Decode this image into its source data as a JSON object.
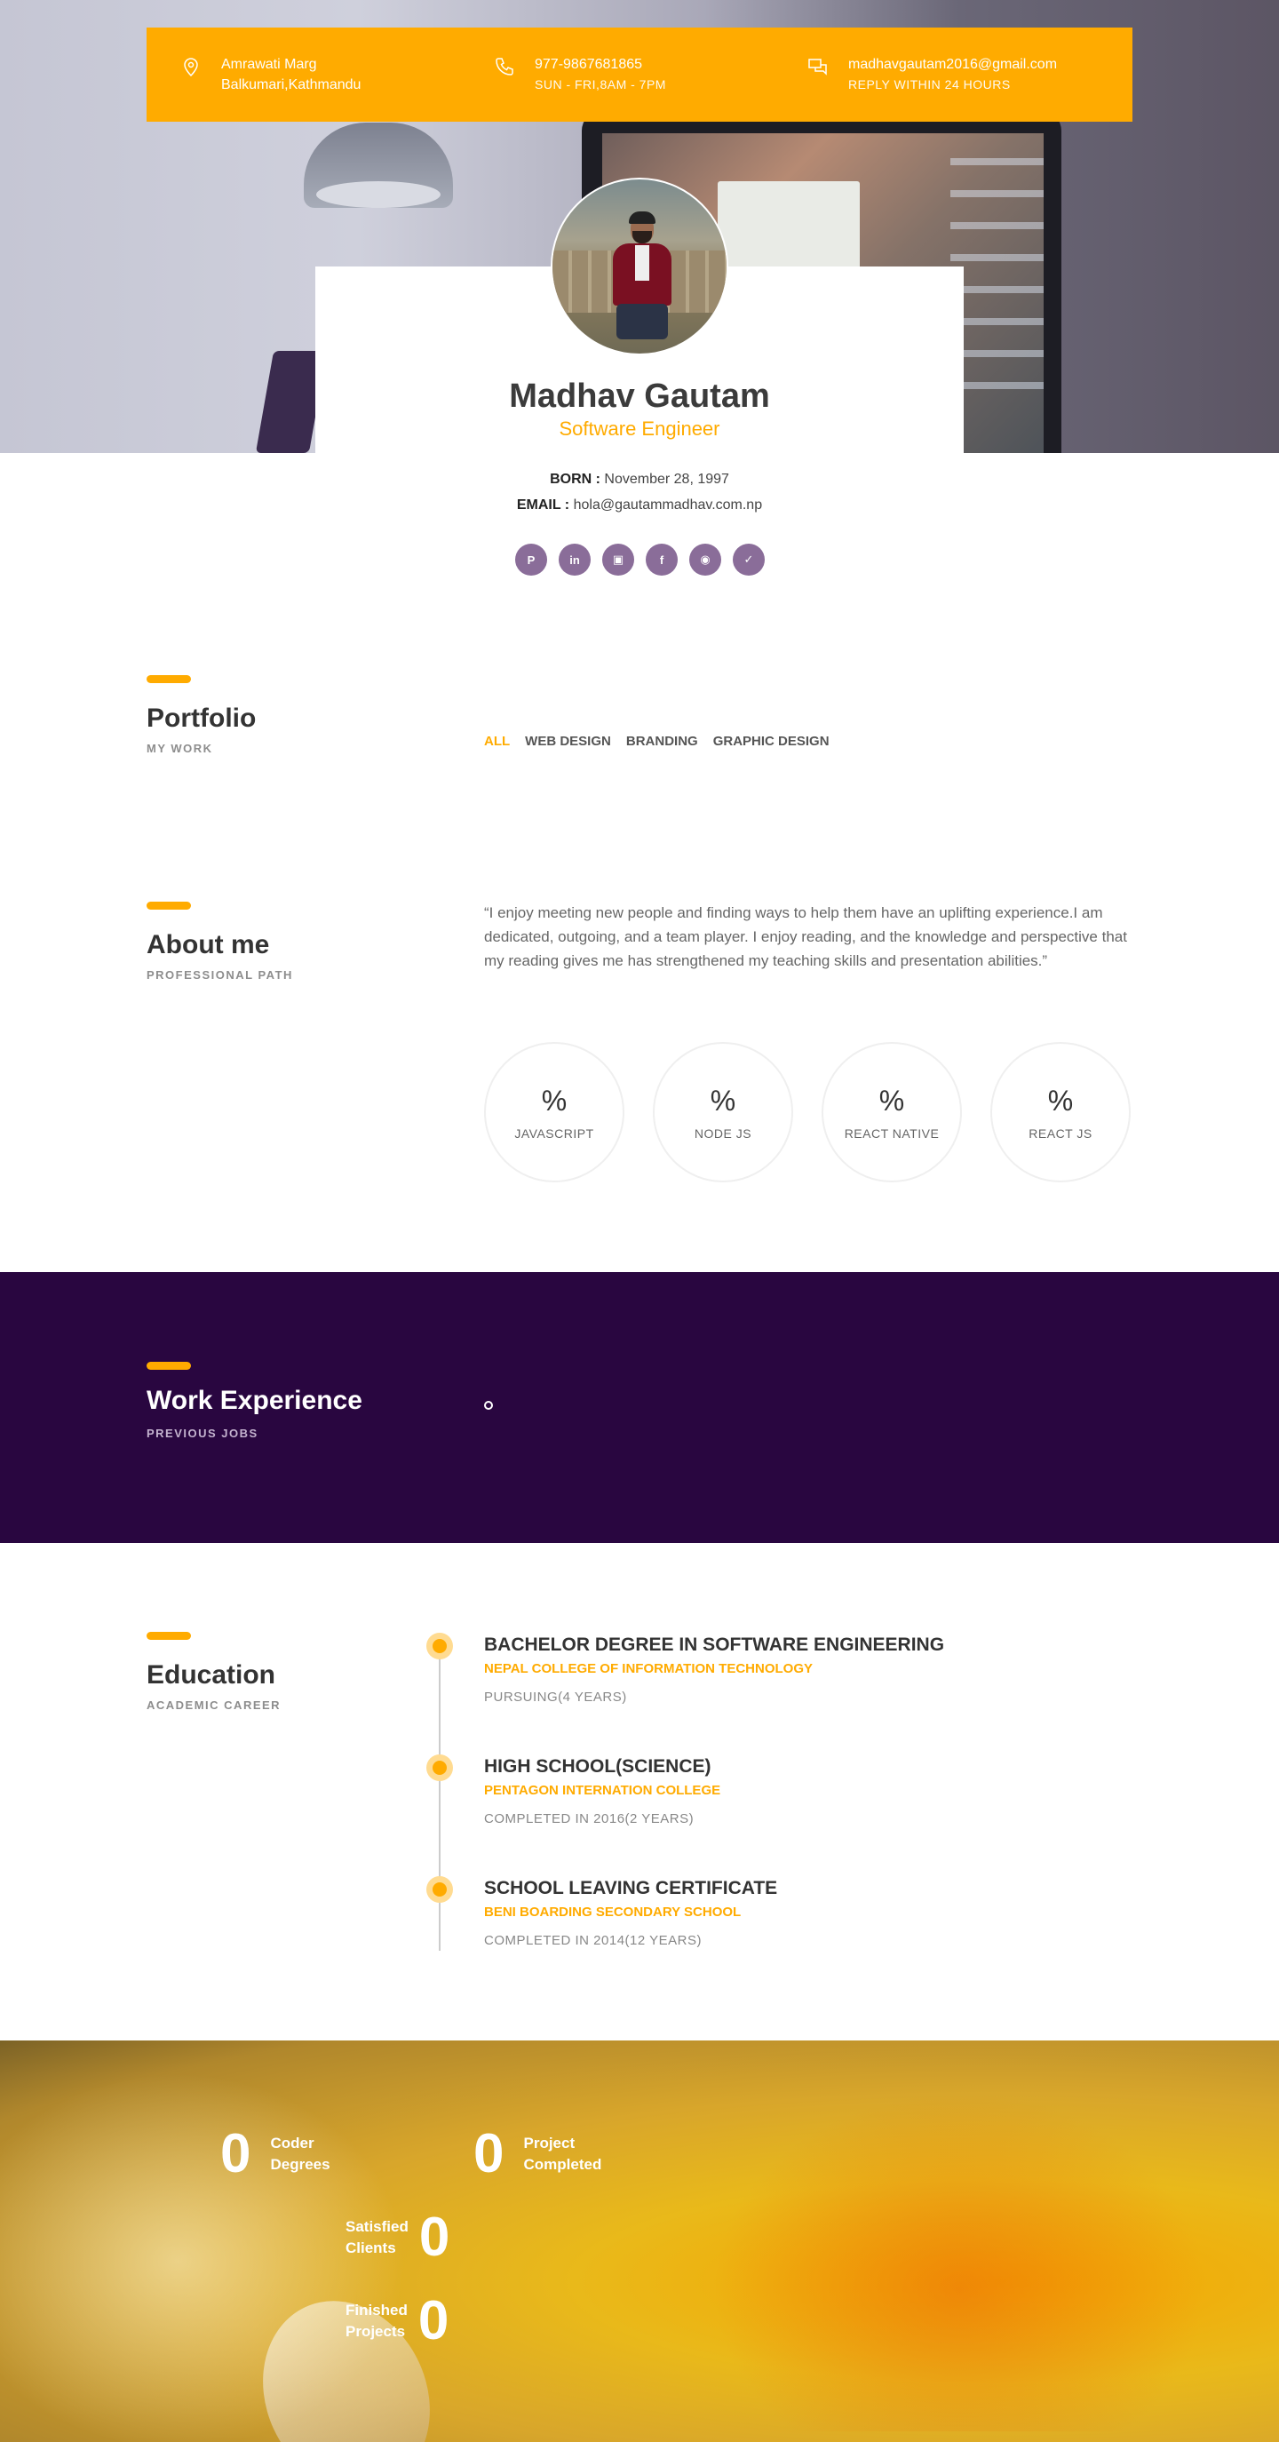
{
  "contact": {
    "address_line1": "Amrawati Marg",
    "address_line2": "Balkumari,Kathmandu",
    "phone": "977-9867681865",
    "hours": "SUN - FRI,8AM - 7PM",
    "email": "madhavgautam2016@gmail.com",
    "reply": "REPLY WITHIN 24 HOURS",
    "icons": [
      "location-pin-icon",
      "phone-icon",
      "chat-icon"
    ],
    "accent_color": "#ffab00"
  },
  "profile": {
    "name": "Madhav Gautam",
    "role": "Software Engineer",
    "born_label": "BORN :",
    "born_value": "November 28, 1997",
    "email_label": "EMAIL :",
    "email_value": "hola@gautammadhav.com.np",
    "social": [
      {
        "icon": "pinterest-icon",
        "glyph": "P"
      },
      {
        "icon": "linkedin-icon",
        "glyph": "in"
      },
      {
        "icon": "instagram-icon",
        "glyph": "▣"
      },
      {
        "icon": "facebook-icon",
        "glyph": "f"
      },
      {
        "icon": "github-icon",
        "glyph": "◉"
      },
      {
        "icon": "twitter-icon",
        "glyph": "✓"
      }
    ]
  },
  "portfolio": {
    "title": "Portfolio",
    "subtitle": "MY WORK",
    "filters": [
      "ALL",
      "WEB DESIGN",
      "BRANDING",
      "GRAPHIC DESIGN"
    ],
    "active_filter": "ALL"
  },
  "about": {
    "title": "About me",
    "subtitle": "PROFESSIONAL PATH",
    "text": "“I enjoy meeting new people and finding ways to help them have an uplifting experience.I am dedicated, outgoing, and a team player. I enjoy reading, and the knowledge and perspective that my reading gives me has strengthened my teaching skills and presentation abilities.”",
    "skills": [
      {
        "percent": "%",
        "label": "JAVASCRIPT"
      },
      {
        "percent": "%",
        "label": "NODE JS"
      },
      {
        "percent": "%",
        "label": "REACT NATIVE"
      },
      {
        "percent": "%",
        "label": "REACT JS"
      }
    ]
  },
  "work": {
    "title": "Work Experience",
    "subtitle": "PREVIOUS JOBS",
    "background": "#290640"
  },
  "education": {
    "title": "Education",
    "subtitle": "ACADEMIC CAREER",
    "items": [
      {
        "degree": "BACHELOR DEGREE IN SOFTWARE ENGINEERING",
        "school": "NEPAL COLLEGE OF INFORMATION TECHNOLOGY",
        "note": "PURSUING(4 YEARS)"
      },
      {
        "degree": "HIGH SCHOOL(SCIENCE)",
        "school": "PENTAGON INTERNATION COLLEGE",
        "note": "COMPLETED IN 2016(2 YEARS)"
      },
      {
        "degree": "SCHOOL LEAVING CERTIFICATE",
        "school": "BENI BOARDING SECONDARY SCHOOL",
        "note": "COMPLETED IN 2014(12 YEARS)"
      }
    ]
  },
  "stats": [
    {
      "value": "0",
      "label1": "Coder",
      "label2": "Degrees"
    },
    {
      "value": "0",
      "label1": "Project",
      "label2": "Completed"
    },
    {
      "value": "0",
      "label1": "Satisfied",
      "label2": "Clients"
    },
    {
      "value": "0",
      "label1": "Finished",
      "label2": "Projects"
    }
  ]
}
